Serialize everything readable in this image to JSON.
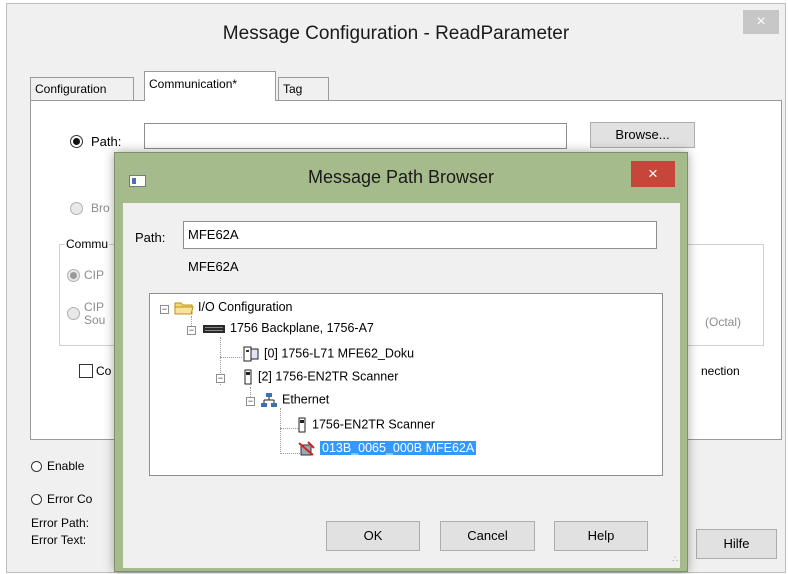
{
  "main": {
    "title": "Message Configuration - ReadParameter",
    "close_glyph": "×",
    "tabs": [
      "Configuration",
      "Communication*",
      "Tag"
    ],
    "path_label": "Path:",
    "path_value": "",
    "browse_label": "Browse...",
    "broadcast_label": "Bro",
    "comm_group_label": "Commu",
    "cip_label": "CIP",
    "cip_source_label_1": "CIP",
    "cip_source_label_2": "Sou",
    "octal_label": "(Octal)",
    "connected_label": "Co",
    "connection_label": "nection",
    "enable_label": "Enable",
    "error_code_label": "Error Co",
    "error_path_label": "Error Path:",
    "error_text_label": "Error Text:",
    "hilfe_label": "Hilfe"
  },
  "dialog": {
    "title": "Message Path Browser",
    "close_glyph": "×",
    "path_label": "Path:",
    "path_value": "MFE62A",
    "path_echo": "MFE62A",
    "ok_label": "OK",
    "cancel_label": "Cancel",
    "help_label": "Help",
    "grip": "∴",
    "tree": {
      "io_config": "I/O Configuration",
      "backplane": "1756 Backplane, 1756-A7",
      "controller": "[0] 1756-L71 MFE62_Doku",
      "scanner": "[2] 1756-EN2TR Scanner",
      "ethernet": "Ethernet",
      "scanner_child": "1756-EN2TR Scanner",
      "device_selected": "013B_0065_000B MFE62A"
    },
    "expander_minus": "−"
  },
  "icons": [
    "app-icon",
    "close-icon",
    "folder-icon",
    "backplane-icon",
    "controller-icon",
    "module-icon",
    "network-icon",
    "device-icon"
  ],
  "colors": {
    "dialog_frame": "#a6bb8c",
    "close_red": "#c7463c",
    "selection": "#3399ff"
  }
}
